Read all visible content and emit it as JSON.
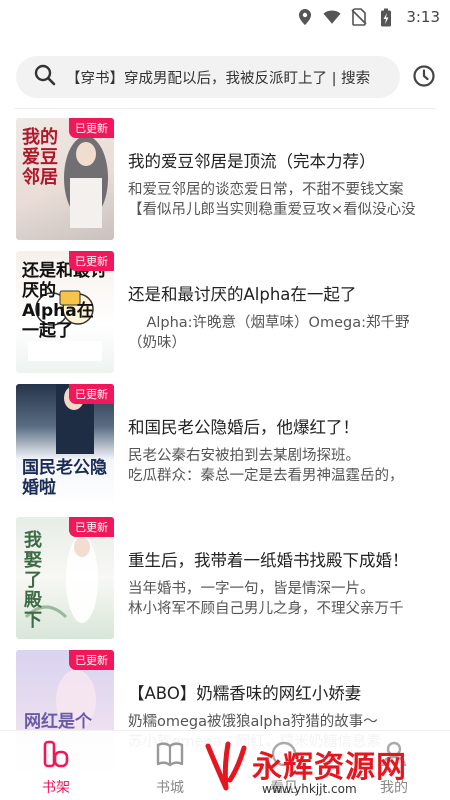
{
  "status_bar": {
    "time": "3:13",
    "icons": [
      "location-icon",
      "wifi-icon",
      "no-sim-icon",
      "battery-charging-icon"
    ]
  },
  "search": {
    "text": "【穿书】穿成男配以后，我被反派盯上了 | 搜索",
    "icon": "search-icon",
    "history_icon": "history-clock-icon"
  },
  "books": [
    {
      "badge": "已更新",
      "title": "我的爱豆邻居是顶流（完本力荐）",
      "desc": "和爱豆邻居的谈恋爱日常，不甜不要钱文案\n【看似吊儿郎当实则稳重爱豆攻×看似没心没",
      "cover_text": "我的爱豆邻居"
    },
    {
      "badge": "已更新",
      "title": "还是和最讨厌的Alpha在一起了",
      "desc": "    Alpha:许晚意（烟草味）Omega:郑千野\n（奶味）",
      "cover_text": "还是和最讨厌的Alpha在一起了"
    },
    {
      "badge": "已更新",
      "title": "和国民老公隐婚后，他爆红了！",
      "desc": "民老公秦右安被拍到去某剧场探班。\n吃瓜群众：秦总一定是去看男神温霆岳的，",
      "cover_text": "国民老公隐婚啦"
    },
    {
      "badge": "已更新",
      "title": "重生后，我带着一纸婚书找殿下成婚！",
      "desc": "当年婚书，一字一句，皆是情深一片。\n林小将军不顾自己男儿之身，不理父亲万千",
      "cover_text": "我娶了殿下"
    },
    {
      "badge": "已更新",
      "title": "【ABO】奶糯香味的网红小娇妻",
      "desc": "奶糯omega被饿狼alpha狩猎的故事～\n苏小软omega，网红，糯米奶糖信息素",
      "cover_text": "网红是个"
    }
  ],
  "nav": [
    {
      "label": "书架",
      "icon": "bookshelf-icon",
      "active": true
    },
    {
      "label": "书城",
      "icon": "open-book-icon",
      "active": false
    },
    {
      "label": "看见",
      "icon": "eye-icon",
      "active": false
    },
    {
      "label": "我的",
      "icon": "person-icon",
      "active": false
    }
  ],
  "watermark": {
    "text": "永辉资源网",
    "url": "www.yhkjjt.com"
  },
  "colors": {
    "accent": "#f0175a",
    "watermark": "#e4161f"
  }
}
